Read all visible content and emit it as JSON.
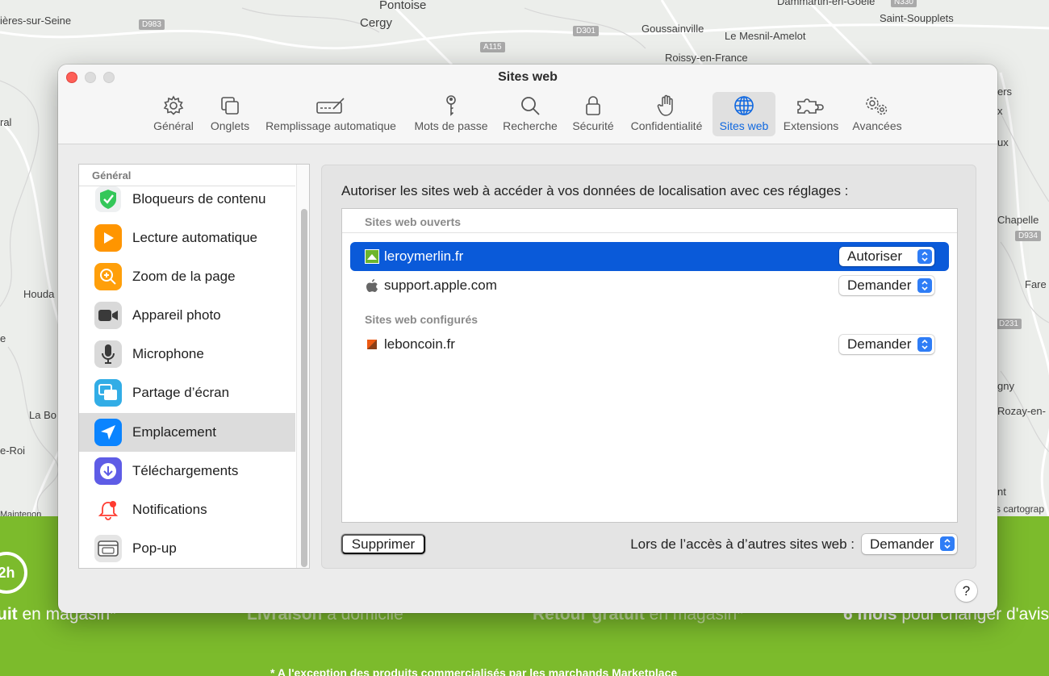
{
  "map": {
    "labels": [
      "Pontoise",
      "Cergy",
      "Goussainville",
      "Le Mesnil-Amelot",
      "Roissy-en-France",
      "Saint-Soupplets",
      "Dammartin-en-Goële",
      "ières-sur-Seine",
      "ral",
      "Houda",
      "La Bo",
      "e-Roi",
      "e",
      "ers",
      "x",
      "ux",
      "Chapelle",
      "Fare",
      "gny",
      "Rozay-en-",
      "nt",
      "s cartograp",
      "Maintenon"
    ],
    "roads": [
      "D983",
      "A115",
      "D301",
      "D934",
      "D231",
      "N330"
    ]
  },
  "banner": {
    "clock": "2h",
    "t1_bold": "uit",
    "t1_rest": " en magasin*",
    "t2_bold": "Livraison",
    "t2_rest": " à domicile",
    "t3_bold": "Retour gratuit",
    "t3_rest": " en magasin*",
    "t4_bold": "6 mois",
    "t4_rest": " pour changer d'avis*",
    "footnote": "* A l'exception des produits commercialisés par les marchands Marketplace"
  },
  "window": {
    "title": "Sites web"
  },
  "toolbar": {
    "items": [
      {
        "label": "Général",
        "icon": "gear-icon"
      },
      {
        "label": "Onglets",
        "icon": "tabs-icon"
      },
      {
        "label": "Remplissage automatique",
        "icon": "autofill-icon"
      },
      {
        "label": "Mots de passe",
        "icon": "key-icon"
      },
      {
        "label": "Recherche",
        "icon": "search-icon"
      },
      {
        "label": "Sécurité",
        "icon": "lock-icon"
      },
      {
        "label": "Confidentialité",
        "icon": "hand-icon"
      },
      {
        "label": "Sites web",
        "icon": "globe-icon",
        "selected": true
      },
      {
        "label": "Extensions",
        "icon": "puzzle-icon"
      },
      {
        "label": "Avancées",
        "icon": "gears-icon"
      }
    ],
    "accent": "#1068e0"
  },
  "sidebar": {
    "header": "Général",
    "items": [
      {
        "label": "Bloqueurs de contenu",
        "icon": "content-blocker-icon",
        "color": "#34c759"
      },
      {
        "label": "Lecture automatique",
        "icon": "play-icon",
        "color": "#ff9500"
      },
      {
        "label": "Zoom de la page",
        "icon": "zoom-icon",
        "color": "#ff9f0a"
      },
      {
        "label": "Appareil photo",
        "icon": "camera-icon",
        "color": "#5a5a5a"
      },
      {
        "label": "Microphone",
        "icon": "microphone-icon",
        "color": "#8e8e93"
      },
      {
        "label": "Partage d’écran",
        "icon": "screen-share-icon",
        "color": "#32ade6"
      },
      {
        "label": "Emplacement",
        "icon": "location-icon",
        "color": "#0a84ff",
        "selected": true
      },
      {
        "label": "Téléchargements",
        "icon": "download-icon",
        "color": "#5e5ce6"
      },
      {
        "label": "Notifications",
        "icon": "bell-icon",
        "color": "#ff3b30"
      },
      {
        "label": "Pop-up",
        "icon": "popup-window-icon",
        "color": "#8e8e93"
      }
    ]
  },
  "content": {
    "description": "Autoriser les sites web à accéder à vos données de localisation avec ces réglages :",
    "open_sites_label": "Sites web ouverts",
    "configured_sites_label": "Sites web configurés",
    "open_sites": [
      {
        "name": "leroymerlin.fr",
        "setting": "Autoriser",
        "icon": "leroymerlin-favicon",
        "selected": true
      },
      {
        "name": "support.apple.com",
        "setting": "Demander",
        "icon": "apple-favicon"
      }
    ],
    "configured_sites": [
      {
        "name": "leboncoin.fr",
        "setting": "Demander",
        "icon": "leboncoin-favicon"
      }
    ],
    "remove_button": "Supprimer",
    "other_sites_label": "Lors de l’accès à d’autres sites web :",
    "other_sites_setting": "Demander",
    "selection_color": "#0a5ad9"
  },
  "help": "?"
}
